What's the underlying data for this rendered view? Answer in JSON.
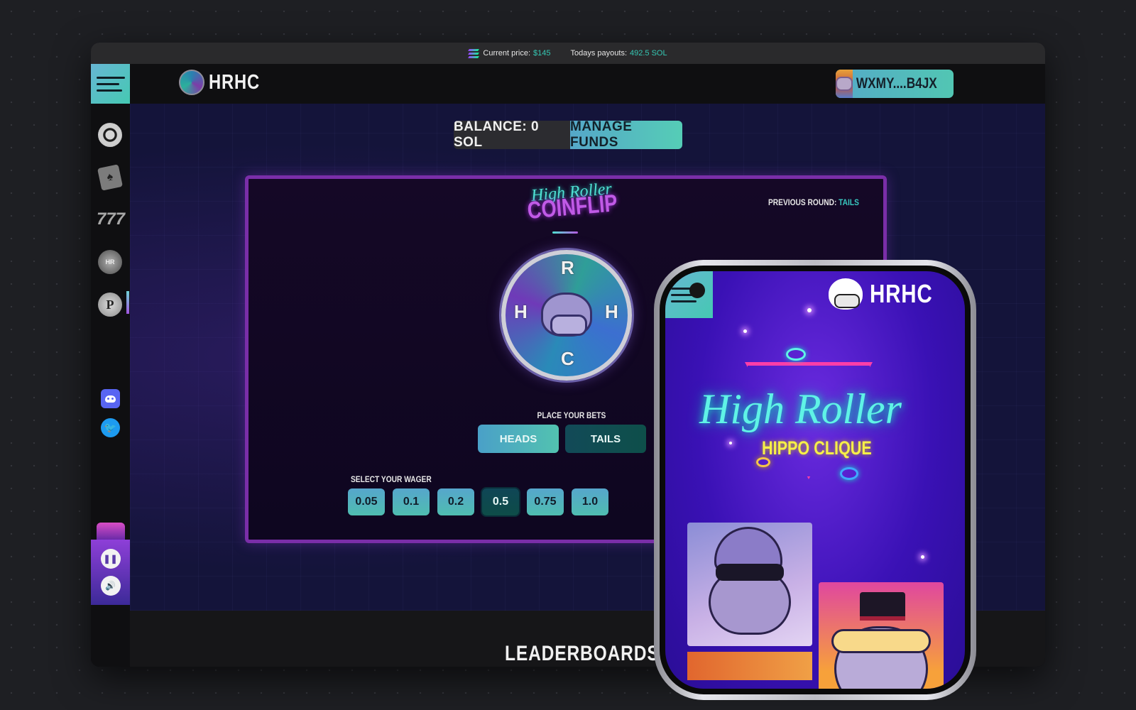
{
  "topbar": {
    "price_label": "Current price:",
    "price_value": "$145",
    "payouts_label": "Todays payouts:",
    "payouts_value": "492.5 SOL"
  },
  "header": {
    "logo_text": "HRHC",
    "wallet_label": "WXMY....B4JX"
  },
  "sidebar": {
    "items": [
      {
        "name": "poker-chip-icon"
      },
      {
        "name": "playing-cards-icon"
      },
      {
        "name": "slots-777-icon",
        "label": "777"
      },
      {
        "name": "coinflip-icon",
        "active": true
      },
      {
        "name": "p-token-icon",
        "label": "P"
      }
    ],
    "social": [
      "discord-icon",
      "twitter-icon"
    ]
  },
  "balance": {
    "label": "BALANCE: 0 SOL",
    "button": "MANAGE FUNDS"
  },
  "game": {
    "title_script": "High Roller",
    "title_main": "COINFLIP",
    "previous_round_label": "PREVIOUS ROUND:",
    "previous_round_value": "TAILS",
    "coin_letters": {
      "top": "R",
      "left": "H",
      "right": "H",
      "bottom": "C"
    },
    "place_bets_label": "PLACE YOUR BETS",
    "heads_label": "HEADS",
    "tails_label": "TAILS",
    "wager_label": "SELECT YOUR WAGER",
    "wagers": [
      "0.05",
      "0.1",
      "0.2",
      "0.5",
      "0.75",
      "1.0"
    ],
    "selected_wager": "0.5"
  },
  "footer": {
    "leaderboards": "LEADERBOARDS"
  },
  "phone": {
    "logo_text": "HRHC",
    "neon_title": "High Roller",
    "neon_subtitle": "HIPPO CLIQUE"
  },
  "colors": {
    "accent_teal": "#52c6b3",
    "accent_blue": "#55a7c9",
    "game_border": "#7a2ea8",
    "value_green": "#35c8b4"
  }
}
